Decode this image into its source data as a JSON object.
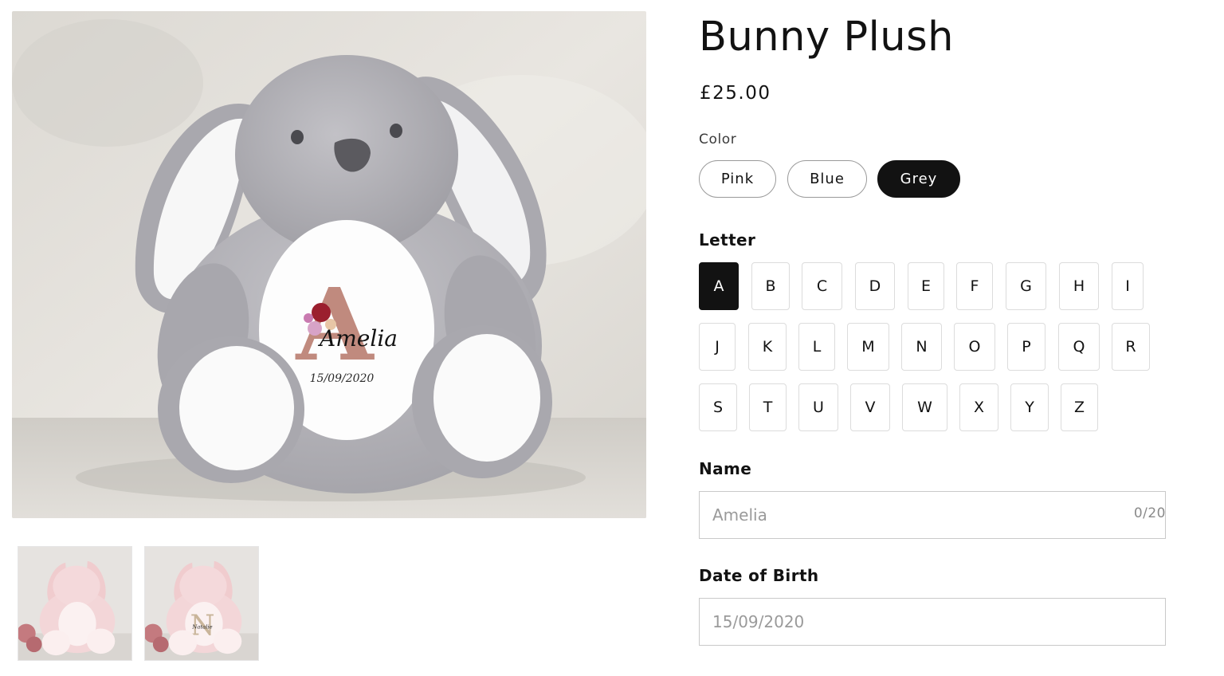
{
  "product": {
    "title": "Bunny Plush",
    "price": "£25.00"
  },
  "main_image": {
    "monogram_letter": "A",
    "print_name": "Amelia",
    "print_date": "15/09/2020"
  },
  "thumbnails": [
    {
      "name": "pink-bunny-plain"
    },
    {
      "name": "pink-bunny-personalised",
      "print_letter": "N",
      "print_name": "Natalie"
    }
  ],
  "color": {
    "label": "Color",
    "options": [
      "Pink",
      "Blue",
      "Grey"
    ],
    "selected": "Grey"
  },
  "letter": {
    "label": "Letter",
    "rows": [
      [
        "A",
        "B",
        "C",
        "D",
        "E",
        "F",
        "G",
        "H",
        "I"
      ],
      [
        "J",
        "K",
        "L",
        "M",
        "N",
        "O",
        "P",
        "Q",
        "R"
      ],
      [
        "S",
        "T",
        "U",
        "V",
        "W",
        "X",
        "Y",
        "Z"
      ]
    ],
    "selected": "A"
  },
  "name_field": {
    "label": "Name",
    "value": "",
    "placeholder": "Amelia",
    "counter": "0/20"
  },
  "dob_field": {
    "label": "Date of Birth",
    "value": "",
    "placeholder": "15/09/2020"
  },
  "colors": {
    "selected_bg": "#121212",
    "border": "#dcdcdc",
    "bunny_grey": "#b4b3b8",
    "bunny_pink": "#f3d6d8",
    "monogram_rose": "#c08a7e"
  }
}
